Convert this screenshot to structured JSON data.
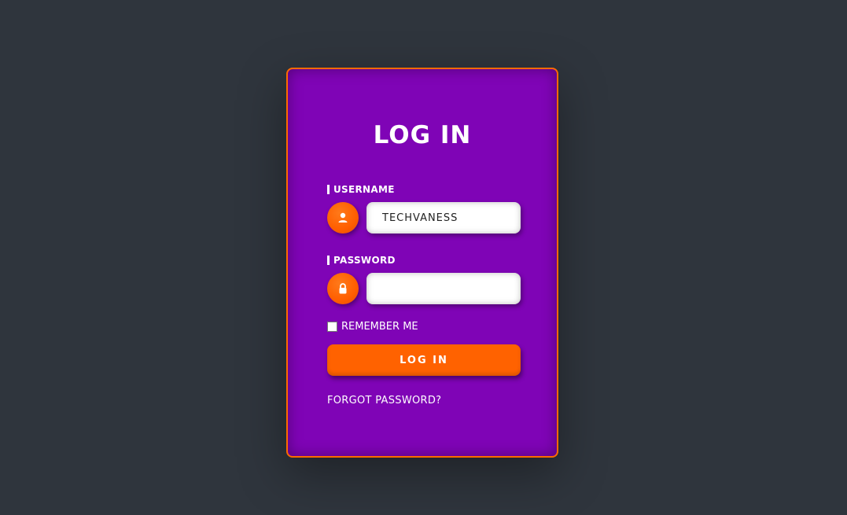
{
  "login": {
    "title": "LOG IN",
    "username_label": "USERNAME",
    "username_value": "TECHVANESS",
    "username_icon": "user-icon",
    "password_label": "PASSWORD",
    "password_value": "",
    "password_icon": "lock-icon",
    "remember_label": "REMEMBER ME",
    "remember_checked": false,
    "submit_label": "LOG IN",
    "forgot_label": "FORGOT PASSWORD?"
  },
  "colors": {
    "background": "#2f353d",
    "card": "#7f04b6",
    "accent": "#ff6200",
    "text": "#ffffff"
  }
}
